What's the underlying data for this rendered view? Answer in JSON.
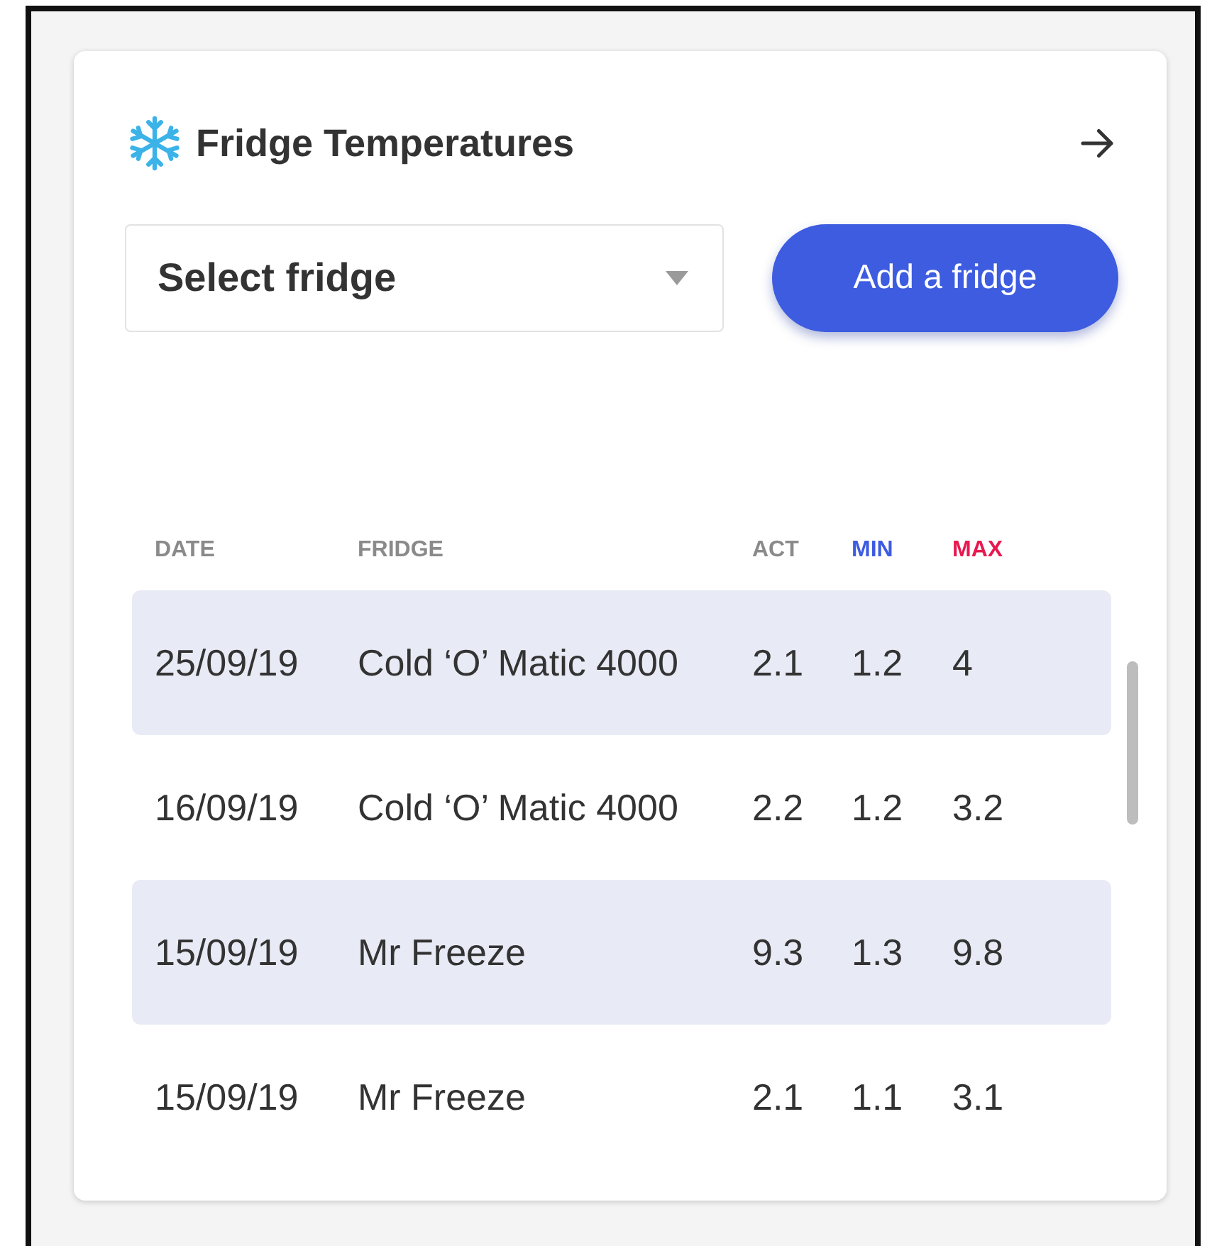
{
  "card": {
    "title": "Fridge Temperatures"
  },
  "select": {
    "placeholder": "Select fridge"
  },
  "add_button": {
    "label": "Add a fridge"
  },
  "table": {
    "columns": [
      {
        "label": "DATE",
        "color": "#8a8a8a"
      },
      {
        "label": "FRIDGE",
        "color": "#8a8a8a"
      },
      {
        "label": "ACT",
        "color": "#8a8a8a"
      },
      {
        "label": "MIN",
        "color": "#3d5ce0"
      },
      {
        "label": "MAX",
        "color": "#e8194f"
      }
    ],
    "rows": [
      [
        "25/09/19",
        "Cold ‘O’ Matic 4000",
        "2.1",
        "1.2",
        "4"
      ],
      [
        "16/09/19",
        "Cold ‘O’ Matic 4000",
        "2.2",
        "1.2",
        "3.2"
      ],
      [
        "15/09/19",
        "Mr Freeze",
        "9.3",
        "1.3",
        "9.8"
      ],
      [
        "15/09/19",
        "Mr Freeze",
        "2.1",
        "1.1",
        "3.1"
      ]
    ]
  }
}
